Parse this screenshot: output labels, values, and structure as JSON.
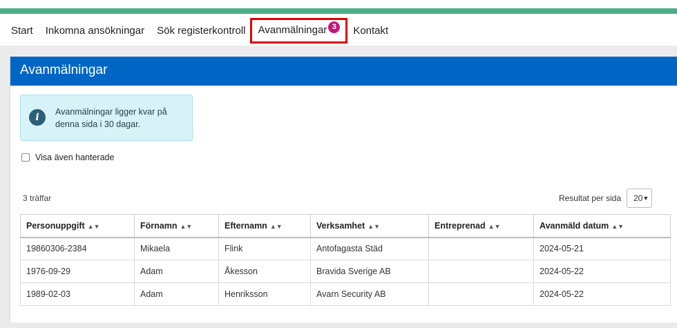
{
  "nav": {
    "items": [
      {
        "label": "Start"
      },
      {
        "label": "Inkomna ansökningar"
      },
      {
        "label": "Sök registerkontroll"
      },
      {
        "label": "Avanmälningar",
        "badge": "3",
        "active": true
      },
      {
        "label": "Kontakt"
      }
    ]
  },
  "panel": {
    "title": "Avanmälningar"
  },
  "info": {
    "icon": "info-icon",
    "text": "Avanmälningar ligger kvar på denna sida i 30 dagar."
  },
  "filter": {
    "show_handled_label": "Visa även hanterade",
    "checked": false
  },
  "results": {
    "hits_label": "3 träffar",
    "per_page_label": "Resultat per sida",
    "per_page_value": "20"
  },
  "table": {
    "columns": [
      "Personuppgift",
      "Förnamn",
      "Efternamn",
      "Verksamhet",
      "Entreprenad",
      "Avanmäld datum"
    ],
    "rows": [
      [
        "19860306-2384",
        "Mikaela",
        "Flink",
        "Antofagasta Städ",
        "",
        "2024-05-21"
      ],
      [
        "1976-09-29",
        "Adam",
        "Åkesson",
        "Bravida Sverige AB",
        "",
        "2024-05-22"
      ],
      [
        "1989-02-03",
        "Adam",
        "Henriksson",
        "Avarn Security AB",
        "",
        "2024-05-22"
      ]
    ]
  },
  "colors": {
    "nav_accent": "#4caf84",
    "header_blue": "#0066c5",
    "badge": "#c0197c",
    "highlight": "#e00000"
  }
}
